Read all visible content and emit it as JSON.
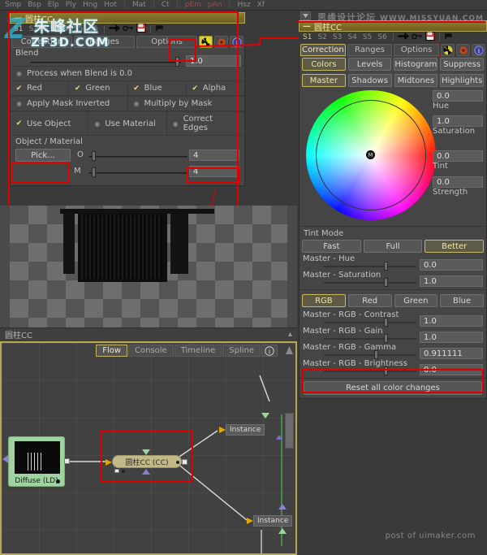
{
  "app": {
    "menu_items": [
      "Smp",
      "Bsp",
      "Elp",
      "Ply",
      "Hng",
      "Hot",
      "|",
      "Mat",
      "|",
      "Ct",
      "|",
      "pEm",
      "pAn",
      "|",
      "Hsz",
      "Xf"
    ],
    "watermark_top": "思缘设计论坛",
    "watermark_top_url": "WWW.MISSYUAN.COM",
    "watermark_bottom": "post of uimaker.com",
    "watermark_left_1": "朱峰社区",
    "watermark_left_2": "ZF3D.COM",
    "watermark_left_mark": "Z"
  },
  "left_panel": {
    "title": "圆柱CC",
    "collapse_glyph": "—",
    "states": [
      "S1",
      "S2",
      "S3",
      "S4",
      "S5",
      "S6"
    ],
    "state_icons": [
      "arrow-right-icon",
      "key-icon",
      "save-icon",
      "pin-icon"
    ],
    "tabs": [
      {
        "label": "Correction",
        "active": false
      },
      {
        "label": "Ranges",
        "active": false
      },
      {
        "label": "Options",
        "active": false
      }
    ],
    "tab_icons": [
      "radioactive-icon",
      "gear-icon",
      "info-icon"
    ],
    "blend": {
      "label": "Blend",
      "value": "1.0",
      "thumb_pct": 96
    },
    "process_when_blend": {
      "label": "Process when Blend is 0.0",
      "checked": false
    },
    "channels": [
      {
        "label": "Red",
        "checked": true
      },
      {
        "label": "Green",
        "checked": true
      },
      {
        "label": "Blue",
        "checked": true
      },
      {
        "label": "Alpha",
        "checked": true
      }
    ],
    "mask_options": [
      {
        "label": "Apply Mask Inverted",
        "checked": false
      },
      {
        "label": "Multiply by Mask",
        "checked": false
      }
    ],
    "object_options": [
      {
        "label": "Use Object",
        "checked": true
      },
      {
        "label": "Use Material",
        "checked": false
      },
      {
        "label": "Correct Edges",
        "checked": false
      }
    ],
    "object_material": {
      "section_label": "Object / Material",
      "pick_label": "Pick...",
      "rows": [
        {
          "label": "O",
          "value": "4",
          "thumb_pct": 6
        },
        {
          "label": "M",
          "value": "4",
          "thumb_pct": 6
        }
      ]
    }
  },
  "viewer": {
    "status_label": "圆柱CC",
    "collapse_glyph": "▴"
  },
  "flow": {
    "tabs": [
      {
        "label": "Flow",
        "active": true
      },
      {
        "label": "Console",
        "active": false
      },
      {
        "label": "Timeline",
        "active": false
      },
      {
        "label": "Spline",
        "active": false
      }
    ],
    "info_icon": "info-icon",
    "nodes": [
      {
        "name": "Diffuse  (LD)",
        "type": "loader"
      },
      {
        "name": "圆柱CC  (CC)",
        "type": "colorcorrect"
      },
      {
        "name": "Instance",
        "type": "instance"
      },
      {
        "name": "Instance",
        "type": "instance"
      }
    ]
  },
  "right_panel": {
    "title": "圆柱CC",
    "collapse_glyph": "—",
    "states": [
      "S1",
      "S2",
      "S3",
      "S4",
      "S5",
      "S6"
    ],
    "tabs": [
      {
        "label": "Correction",
        "active": true
      },
      {
        "label": "Ranges",
        "active": false
      },
      {
        "label": "Options",
        "active": false
      }
    ],
    "tab_icons": [
      "radioactive-icon",
      "gear-icon",
      "info-icon"
    ],
    "mode_row_1": [
      {
        "label": "Colors",
        "active": true
      },
      {
        "label": "Levels",
        "active": false
      },
      {
        "label": "Histogram",
        "active": false
      },
      {
        "label": "Suppress",
        "active": false
      }
    ],
    "mode_row_2": [
      {
        "label": "Master",
        "active": true
      },
      {
        "label": "Shadows",
        "active": false
      },
      {
        "label": "Midtones",
        "active": false
      },
      {
        "label": "Highlights",
        "active": false
      }
    ],
    "wheel_fields": [
      {
        "value": "0.0",
        "label": "Hue"
      },
      {
        "value": "1.0",
        "label": "Saturation"
      },
      {
        "value": "0.0",
        "label": "Tint"
      },
      {
        "value": "0.0",
        "label": "Strength"
      }
    ],
    "tint_mode": {
      "label": "Tint Mode",
      "options": [
        {
          "label": "Fast",
          "active": false
        },
        {
          "label": "Full",
          "active": false
        },
        {
          "label": "Better",
          "active": true
        }
      ]
    },
    "master_sliders": [
      {
        "label": "Master - Hue",
        "value": "0.0",
        "thumb_pct": 50,
        "highlight": false
      },
      {
        "label": "Master - Saturation",
        "value": "1.0",
        "thumb_pct": 50,
        "highlight": false
      }
    ],
    "rgb_tabs": [
      {
        "label": "RGB",
        "active": true
      },
      {
        "label": "Red",
        "active": false
      },
      {
        "label": "Green",
        "active": false
      },
      {
        "label": "Blue",
        "active": false
      }
    ],
    "rgb_sliders": [
      {
        "label": "Master - RGB - Contrast",
        "value": "1.0",
        "thumb_pct": 50,
        "highlight": false
      },
      {
        "label": "Master - RGB - Gain",
        "value": "1.0",
        "thumb_pct": 50,
        "highlight": false
      },
      {
        "label": "Master - RGB - Gamma",
        "value": "0.911111",
        "thumb_pct": 44,
        "highlight": true
      },
      {
        "label": "Master - RGB - Brightness",
        "value": "0.0",
        "thumb_pct": 50,
        "highlight": false
      }
    ],
    "reset_button": "Reset all color changes"
  },
  "colors": {
    "accent_gold": "#b9a84a",
    "highlight_red": "#e00000",
    "panel_bg": "#454545",
    "app_bg": "#3a3a3a"
  }
}
